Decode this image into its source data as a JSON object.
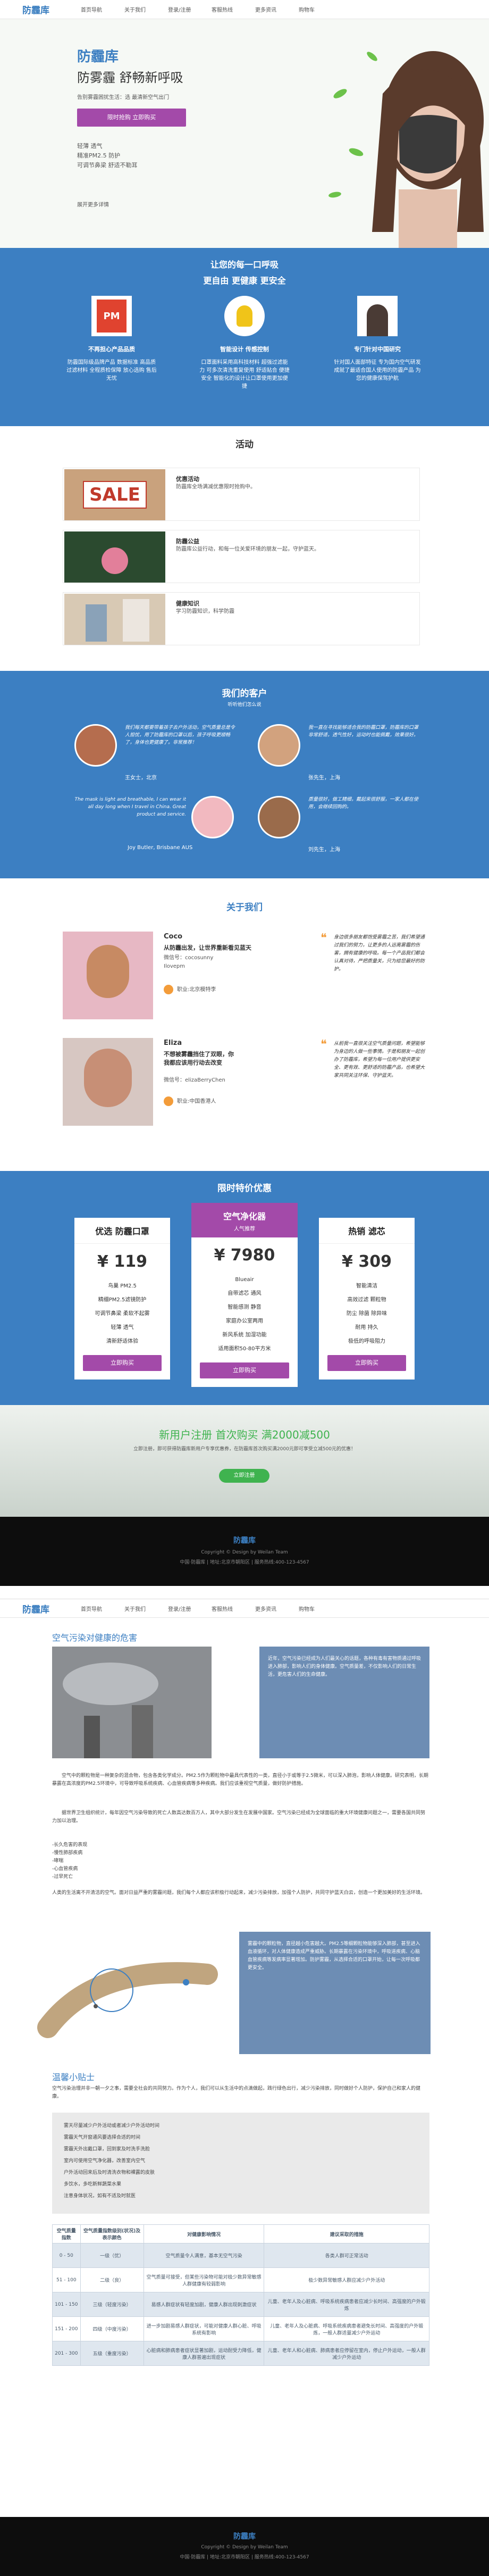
{
  "nav1": {
    "logo": "防霾库",
    "links": [
      "首页导航",
      "关于我们",
      "登录/注册",
      "客服热线",
      "更多资讯",
      "购物车"
    ]
  },
  "hero": {
    "title": "防霾库",
    "subtitle": "防雾霾 舒畅新呼吸",
    "desc1": "告别雾霾困扰生活：选 最清新空气出门",
    "button": "限时抢购 立即购买",
    "checks": [
      "轻薄 透气",
      "精准PM2.5 防护",
      "可调节鼻梁 舒适不勒耳"
    ],
    "bottom_link": "展开更多详情"
  },
  "features": {
    "title": "让您的每一口呼吸",
    "subtitle": "更自由 更健康 更安全",
    "items": [
      {
        "title": "不再担心产品品质",
        "desc": "防霾国际级品牌产品 数据标准 高品质过滤材料 全程质检保障 放心选购 售后无忧"
      },
      {
        "title": "智能设计 传感控制",
        "desc": "口罩面料采用高科技材料 超强过滤能力 可多次清洗重复使用 舒适贴合 便捷安全 智能化的设计让口罩使用更加便捷"
      },
      {
        "title": "专门针对中国研究",
        "desc": "针对国人面部特征 专为国内空气研发 成就了最适合国人使用的防霾产品 为您的健康保驾护航"
      }
    ]
  },
  "activity": {
    "title": "活动",
    "items": [
      {
        "title": "优惠活动",
        "desc": "防霾库全场满减优惠限时抢购中。"
      },
      {
        "title": "防霾公益",
        "desc": "防霾库公益行动，和每一位关爱环境的朋友一起，守护蓝天。"
      },
      {
        "title": "健康知识",
        "desc": "学习防霾知识，科学防霾"
      }
    ]
  },
  "customers": {
    "title": "我们的客户",
    "subtitle": "听听他们怎么说",
    "items": [
      {
        "quote": "我们每天都要带着孩子去户外活动，空气质量总是令人担忧，用了防霾库的口罩以后，孩子呼吸更顺畅了，身体也更健康了。非常推荐！",
        "name": "王女士，北京"
      },
      {
        "quote": "我一直在寻找能够适合我的防霾口罩，防霾库的口罩非常舒适，透气性好，运动时也能佩戴，效果很好。",
        "name": "张先生，上海"
      },
      {
        "quote": "The mask is light and breathable, I can wear it all day long when I travel in China. Great product and service.",
        "name": "Joy Butler, Brisbane AUS"
      },
      {
        "quote": "质量很好，做工精细，戴起来很舒服，一家人都在使用，会继续回购的。",
        "name": "刘先生，上海"
      }
    ]
  },
  "about": {
    "title": "关于我们",
    "people": [
      {
        "name": "Coco",
        "headline": "从防霾出发，让世界重新看见蓝天",
        "role": "微信号：cocosunny",
        "handle": "Ilovepm",
        "loc": "职业:北京模特李",
        "quote": "身边很多朋友都饱受雾霾之苦，我们希望通过我们的努力，让更多的人远离雾霾的伤害，拥有健康的呼吸。每一个产品我们都会认真对待，严把质量关，只为给您最好的防护。"
      },
      {
        "name": "Eliza",
        "headline": "不想被雾霾挡住了双眼，你我都应该用行动去改变",
        "role": "微信号：elizaBerryChen",
        "handle": "",
        "loc": "职业:中国香港人",
        "quote": "从前我一直很关注空气质量问题，希望能够为身边的人做一些事情。于是和朋友一起创办了防霾库，希望为每一位用户提供更安全、更有效、更舒适的防霾产品，也希望大家共同关注环保、守护蓝天。"
      }
    ]
  },
  "pricing": {
    "title": "限时特价优惠",
    "plans": [
      {
        "title": "优选 防霾口罩",
        "badge": "",
        "price": "¥ 119",
        "feats": [
          "鸟巢 PM2.5",
          "精细PM2.5滤镜防护",
          "可调节鼻梁 柔软不起雾",
          "轻薄 透气",
          "清新舒适体验"
        ],
        "btn": "立即购买"
      },
      {
        "title": "空气净化器",
        "badge": "人气推荐",
        "price": "¥ 7980",
        "feats": [
          "Blueair",
          "自带滤芯 通风",
          "智能感测 静音",
          "家庭办公室两用",
          "新风系统 加湿功能",
          "适用面积50-80平方米"
        ],
        "btn": "立即购买"
      },
      {
        "title": "热销 滤芯",
        "badge": "",
        "price": "¥ 309",
        "feats": [
          "智能清洁",
          "高效过滤 颗粒物",
          "防尘 除菌 除异味",
          "耐用 持久",
          "极低的呼吸阻力"
        ],
        "btn": "立即购买"
      }
    ]
  },
  "promo": {
    "title": "新用户注册 首次购买 满2000减500",
    "desc": "立即注册，即可获得防霾库新用户专享优惠券，在防霾库首次购买满2000元即可享受立减500元的优惠！",
    "btn": "立即注册"
  },
  "footer1": {
    "title": "防霾库",
    "line1": "Copyright © Design by Weilan Team",
    "line2": "中国·防霾库 | 地址:北京市朝阳区 | 服务热线:400-123-4567"
  },
  "nav2": {
    "logo": "防霾库",
    "links": [
      "首页导航",
      "关于我们",
      "登录/注册",
      "客服热线",
      "更多资讯",
      "购物车"
    ]
  },
  "article": {
    "title": "空气污染对健康的危害",
    "sidebar": "近年，空气污染已经成为人们最关心的话题，各种有毒有害物质通过呼吸进入肺部，影响人们的身体健康。空气质量差，不仅影响人们的日常生活，更危害人们的生命健康。",
    "p1": "空气中的颗粒物是一种复杂的混合物，包含各类化学成分。PM2.5作为颗粒物中最具代表性的一类，直径小于或等于2.5微米，可以深入肺泡，影响人体健康。研究表明，长期暴露在高浓度的PM2.5环境中，可导致呼吸系统疾病、心血管疾病等多种疾病。我们应该重视空气质量，做好防护措施。",
    "p2": "据世界卫生组织统计，每年因空气污染导致的死亡人数高达数百万人，其中大部分发生在发展中国家。空气污染已经成为全球面临的重大环境健康问题之一，需要各国共同努力加以治理。",
    "list": [
      "-长久危害的表现",
      "-慢性肺部疾病",
      "-哮喘",
      "-心血管疾病",
      "-过早死亡"
    ],
    "p3": "人类的生活离不开清洁的空气。面对日益严重的雾霾问题，我们每个人都应该积极行动起来，减少污染排放，加强个人防护，共同守护蓝天白云，创造一个更加美好的生活环境。",
    "side2": "雾霾中的颗粒物，直径越小危害越大。PM2.5等细颗粒物能够深入肺部，甚至进入血液循环，对人体健康造成严重威胁。长期暴露在污染环境中，呼吸道疾病、心脑血管疾病等发病率显著增加。防护雾霾，从选择合适的口罩开始，让每一次呼吸都更安全。",
    "tips_title": "温馨小贴士",
    "tips_desc": "空气污染治理并非一朝一夕之事，需要全社会的共同努力。作为个人，我们可以从生活中的点滴做起，践行绿色出行，减少污染排放，同时做好个人防护，保护自己和家人的健康。",
    "tips": [
      "雾天尽量减少户外活动或者减少户外活动时间",
      "雾霾天气开窗通风要选择合适的时间",
      "雾霾天外出戴口罩，回到家及时洗手洗脸",
      "室内可使用空气净化器，改善室内空气",
      "户外活动回来后及时清洗衣物和裸露的皮肤",
      "多饮水，多吃新鲜蔬菜水果",
      "注意身体状况，如有不适及时就医"
    ],
    "table_head": [
      "空气质量指数",
      "空气质量指数级别(状况)及表示颜色",
      "对健康影响情况",
      "建议采取的措施"
    ],
    "table_rows": [
      [
        "0 - 50",
        "一级（优）",
        "空气质量令人满意，基本无空气污染",
        "各类人群可正常活动"
      ],
      [
        "51 - 100",
        "二级（良）",
        "空气质量可接受，但某些污染物可能对极少数异常敏感人群健康有较弱影响",
        "极少数异常敏感人群应减少户外活动"
      ],
      [
        "101 - 150",
        "三级（轻度污染）",
        "易感人群症状有轻度加剧，健康人群出现刺激症状",
        "儿童、老年人及心脏病、呼吸系统疾病患者应减少长时间、高强度的户外锻炼"
      ],
      [
        "151 - 200",
        "四级（中度污染）",
        "进一步加剧易感人群症状，可能对健康人群心脏、呼吸系统有影响",
        "儿童、老年人及心脏病、呼吸系统疾病患者避免长时间、高强度的户外锻炼，一般人群适量减少户外运动"
      ],
      [
        "201 - 300",
        "五级（重度污染）",
        "心脏病和肺病患者症状显著加剧，运动耐受力降低，健康人群普遍出现症状",
        "儿童、老年人和心脏病、肺病患者应停留在室内，停止户外运动，一般人群减少户外运动"
      ]
    ]
  },
  "footer2": {
    "title": "防霾库",
    "line1": "Copyright © Design by Weilan Team",
    "line2": "中国·防霾库 | 地址:北京市朝阳区 | 服务热线:400-123-4567"
  },
  "colors": {
    "accent": "#3c7fc2",
    "purple": "#a34aa9",
    "green": "#3fb34f"
  }
}
